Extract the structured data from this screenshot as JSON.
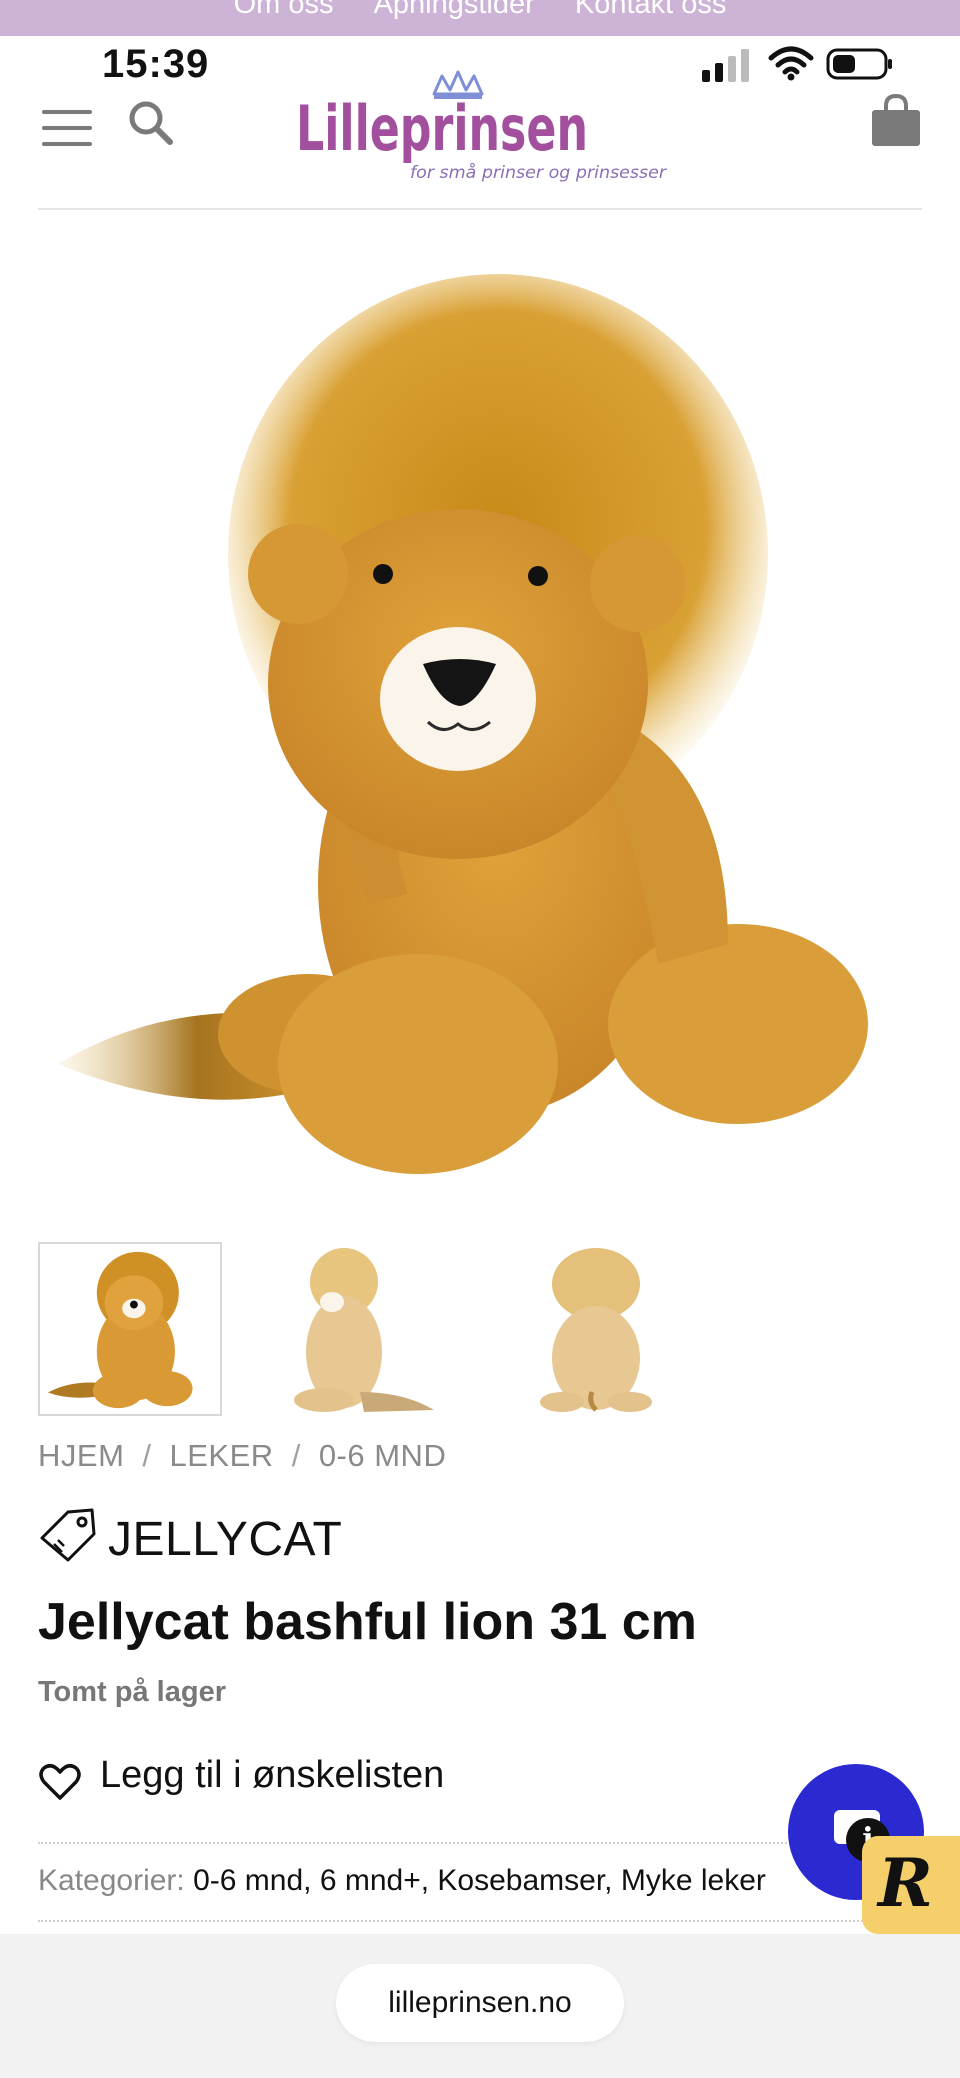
{
  "top_nav": {
    "links": [
      "Om oss",
      "Åpningstider",
      "Kontakt oss"
    ]
  },
  "status_bar": {
    "time": "15:39"
  },
  "header": {
    "logo_text": "Lilleprinsen",
    "logo_tagline": "for små prinser og prinsesser",
    "icons": [
      "menu-icon",
      "search-icon",
      "bag-icon"
    ]
  },
  "product": {
    "image_alt": "Jellycat bashful lion plush",
    "thumbnails": [
      "front",
      "side",
      "back"
    ],
    "breadcrumb": [
      "HJEM",
      "LEKER",
      "0-6 MND"
    ],
    "brand": "JELLYCAT",
    "title": "Jellycat bashful lion 31 cm",
    "stock": "Tomt på lager",
    "wishlist_label": "Legg til i ønskelisten",
    "categories_label": "Kategorier:",
    "categories": [
      "0-6 mnd",
      "6 mnd+",
      "Kosebamser",
      "Myke leker"
    ]
  },
  "widgets": {
    "info_badge": "i",
    "r_badge": "R"
  },
  "browser": {
    "url": "lilleprinsen.no"
  },
  "colors": {
    "topbar": "#cdb4d6",
    "logo": "#a24f9d",
    "chat": "#2a2ad0",
    "r_badge": "#f5cf6a"
  }
}
